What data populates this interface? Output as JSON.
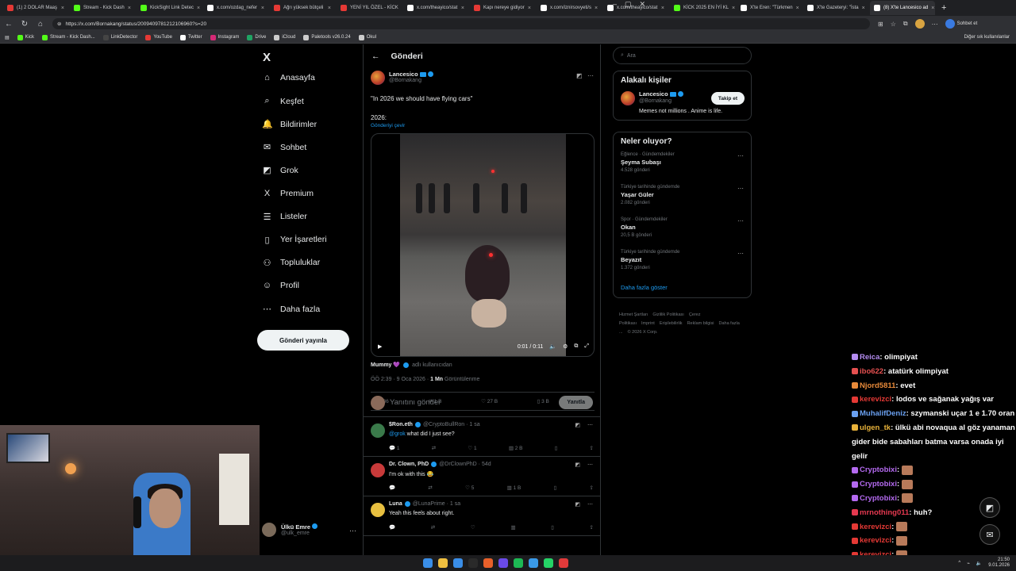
{
  "browser": {
    "tabs": [
      {
        "label": "(1) 2 DOLAR Maaş",
        "color": "#e53935"
      },
      {
        "label": "Stream - Kick Dash",
        "color": "#53fc18"
      },
      {
        "label": "KickSight Link Detec",
        "color": "#53fc18"
      },
      {
        "label": "x.com/ozdag_nefer",
        "color": "#ffffff"
      },
      {
        "label": "Ağrı yüksek bütçeli",
        "color": "#e53935"
      },
      {
        "label": "YENİ YIL ÖZEL - KİCK",
        "color": "#e53935"
      },
      {
        "label": "x.com/theayico/stat",
        "color": "#ffffff"
      },
      {
        "label": "Kapı nereye gidiyor",
        "color": "#e53935"
      },
      {
        "label": "x.com/iznirsovyeti/s",
        "color": "#ffffff"
      },
      {
        "label": "x.com/theayico/stat",
        "color": "#ffffff"
      },
      {
        "label": "KİCK 2025 EN İYİ KL",
        "color": "#53fc18"
      },
      {
        "label": "X'te Eren: \"Türkmen",
        "color": "#ffffff"
      },
      {
        "label": "X'te Gazeteryi: \"İsta",
        "color": "#ffffff"
      },
      {
        "label": "(8) X'te Lancesico ad",
        "color": "#ffffff",
        "active": true
      }
    ],
    "new_tab": "+",
    "url": "https://x.com/Bornakang/status/2009409781212106960?s=20",
    "chat_button": "Sohbet et",
    "bookmarks": [
      {
        "label": "Kick",
        "color": "#53fc18"
      },
      {
        "label": "Stream - Kick Dash...",
        "color": "#53fc18"
      },
      {
        "label": "LinkDetector",
        "color": "#444"
      },
      {
        "label": "YouTube",
        "color": "#e53935"
      },
      {
        "label": "Twitter",
        "color": "#ffffff"
      },
      {
        "label": "Instagram",
        "color": "#d62976"
      },
      {
        "label": "Drive",
        "color": "#1fa463"
      },
      {
        "label": "iCloud",
        "color": "#cccccc"
      },
      {
        "label": "Paletools v26.0.24",
        "color": "#cccccc"
      },
      {
        "label": "Okul",
        "color": "#cccccc"
      }
    ],
    "other_bookmarks": "Diğer sık kullanılanlar"
  },
  "nav": {
    "logo": "X",
    "items": [
      {
        "label": "Anasayfa",
        "icon": "⌂"
      },
      {
        "label": "Keşfet",
        "icon": "⌕"
      },
      {
        "label": "Bildirimler",
        "icon": "🔔"
      },
      {
        "label": "Sohbet",
        "icon": "✉"
      },
      {
        "label": "Grok",
        "icon": "◩"
      },
      {
        "label": "Premium",
        "icon": "X"
      },
      {
        "label": "Listeler",
        "icon": "☰"
      },
      {
        "label": "Yer İşaretleri",
        "icon": "▯"
      },
      {
        "label": "Topluluklar",
        "icon": "⚇"
      },
      {
        "label": "Profil",
        "icon": "☺"
      },
      {
        "label": "Daha fazla",
        "icon": "⋯"
      }
    ],
    "post_button": "Gönderi yayınla",
    "account": {
      "name": "Ülkü Emre",
      "handle": "@ulk_emre"
    }
  },
  "main": {
    "title": "Gönderi",
    "tweet": {
      "name": "Lancesico",
      "handle": "@Bornakang",
      "text1": "\"In 2026 we should have flying cars\"",
      "text2": "2026:",
      "translate": "Gönderiyi çevir",
      "video_time": "0:01 / 0:11",
      "mummy": "Mummy 💜",
      "mummy_from": "adlı kullanıcıdan",
      "meta_time": "ÖÖ 2:39 · 9 Oca 2026 ·",
      "meta_views": "1 Mn",
      "meta_views_label": "Görüntülenme",
      "replies": "486",
      "reposts": "1 B",
      "likes": "27 B",
      "bookmarks": "3 B"
    },
    "reply_placeholder": "Yanıtını gönder",
    "reply_button": "Yanıtla",
    "replies": [
      {
        "name": "$Ron.eth",
        "handle": "@CryptoBullRon · 1 sa",
        "mention": "@grok",
        "text": " what did I just see?",
        "r": "1",
        "rt": "",
        "l": "1",
        "v": "2 B",
        "color": "#3a7a4a"
      },
      {
        "name": "Dr. Clown, PhD",
        "handle": "@DrClownPhD · 54d",
        "mention": "",
        "text": "I'm ok with this 😂",
        "r": "",
        "rt": "",
        "l": "5",
        "v": "1 B",
        "color": "#c83a3a"
      },
      {
        "name": "Luna",
        "handle": "@LunaPrime · 1 sa",
        "mention": "",
        "text": "Yeah this feels about right.",
        "r": "",
        "rt": "",
        "l": "",
        "v": "",
        "color": "#e8c040"
      }
    ]
  },
  "sidebar": {
    "search_placeholder": "Ara",
    "related_title": "Alakalı kişiler",
    "related": {
      "name": "Lancesico",
      "handle": "@Bornakang",
      "bio": "Memes not millions . Anime is life.",
      "follow": "Takip et"
    },
    "trends_title": "Neler oluyor?",
    "trends": [
      {
        "cat": "Eğlence · Gündemdekiler",
        "title": "Şeyma Subaşı",
        "count": "4.528 gönderi"
      },
      {
        "cat": "Türkiye tarihinde gündemde",
        "title": "Yaşar Güler",
        "count": "2.082 gönderi"
      },
      {
        "cat": "Spor · Gündemdekiler",
        "title": "Okan",
        "count": "20,5 B gönderi"
      },
      {
        "cat": "Türkiye tarihinde gündemde",
        "title": "Beyazıt",
        "count": "1.372 gönderi"
      }
    ],
    "show_more": "Daha fazla göster",
    "footer": [
      "Hizmet Şartları",
      "Gizlilik Politikası",
      "Çerez Politikası",
      "Imprint",
      "Erişilebilirlik",
      "Reklam bilgisi",
      "Daha fazla ...",
      "© 2026 X Corp."
    ]
  },
  "chat": [
    {
      "user": "Reica",
      "color": "#b48cf0",
      "msg": ": olimpiyat"
    },
    {
      "user": "ibo622",
      "color": "#e55050",
      "msg": ": atatürk olimpiyat"
    },
    {
      "user": "Njord5811",
      "color": "#e88a3a",
      "msg": ": evet"
    },
    {
      "user": "kerevizci",
      "color": "#e53935",
      "msg": ": lodos ve sağanak yağış var"
    },
    {
      "user": "MuhalifDeniz",
      "color": "#6aa0f0",
      "msg": ": szymanski uçar 1 e 1.70 oran"
    },
    {
      "user": "ulgen_tk",
      "color": "#e8b23a",
      "msg": ": ülkü abi novaqua al göz yanaman gider bide sabahları batma varsa onada iyi gelir"
    },
    {
      "user": "Cryptobixi",
      "color": "#b46af0",
      "msg": ":"
    },
    {
      "user": "Cryptobixi",
      "color": "#b46af0",
      "msg": ":"
    },
    {
      "user": "Cryptobixi",
      "color": "#b46af0",
      "msg": ":"
    },
    {
      "user": "mrnothing011",
      "color": "#e53950",
      "msg": ": huh?"
    },
    {
      "user": "kerevizci",
      "color": "#e53935",
      "msg": ":"
    },
    {
      "user": "kerevizci",
      "color": "#e53935",
      "msg": ":"
    },
    {
      "user": "kerevizci",
      "color": "#e53935",
      "msg": ":"
    }
  ],
  "taskbar": {
    "time": "21:50",
    "date": "9.01.2026"
  }
}
